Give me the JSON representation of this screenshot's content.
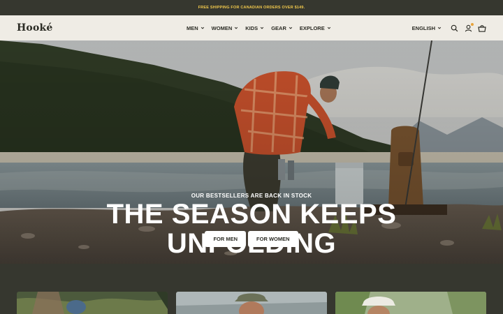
{
  "announcement": {
    "text": "FREE SHIPPING FOR CANADIAN ORDERS OVER $149."
  },
  "header": {
    "logo": "Hooké",
    "nav": [
      "MEN",
      "WOMEN",
      "KIDS",
      "GEAR",
      "EXPLORE"
    ],
    "language": "ENGLISH",
    "icons": [
      "search-icon",
      "account-icon",
      "cart-icon"
    ],
    "account_badge_color": "#e8a33a"
  },
  "hero": {
    "eyebrow": "OUR BESTSELLERS ARE BACK IN STOCK",
    "headline_line1": "THE SEASON KEEPS",
    "headline_line2": "UNFOLDING",
    "cta_men": "FOR MEN",
    "cta_women": "FOR WOMEN"
  },
  "colors": {
    "announcement_bg": "#36372f",
    "announcement_text": "#f2c94c",
    "header_bg": "#efece5",
    "text_dark": "#2b2b24"
  }
}
